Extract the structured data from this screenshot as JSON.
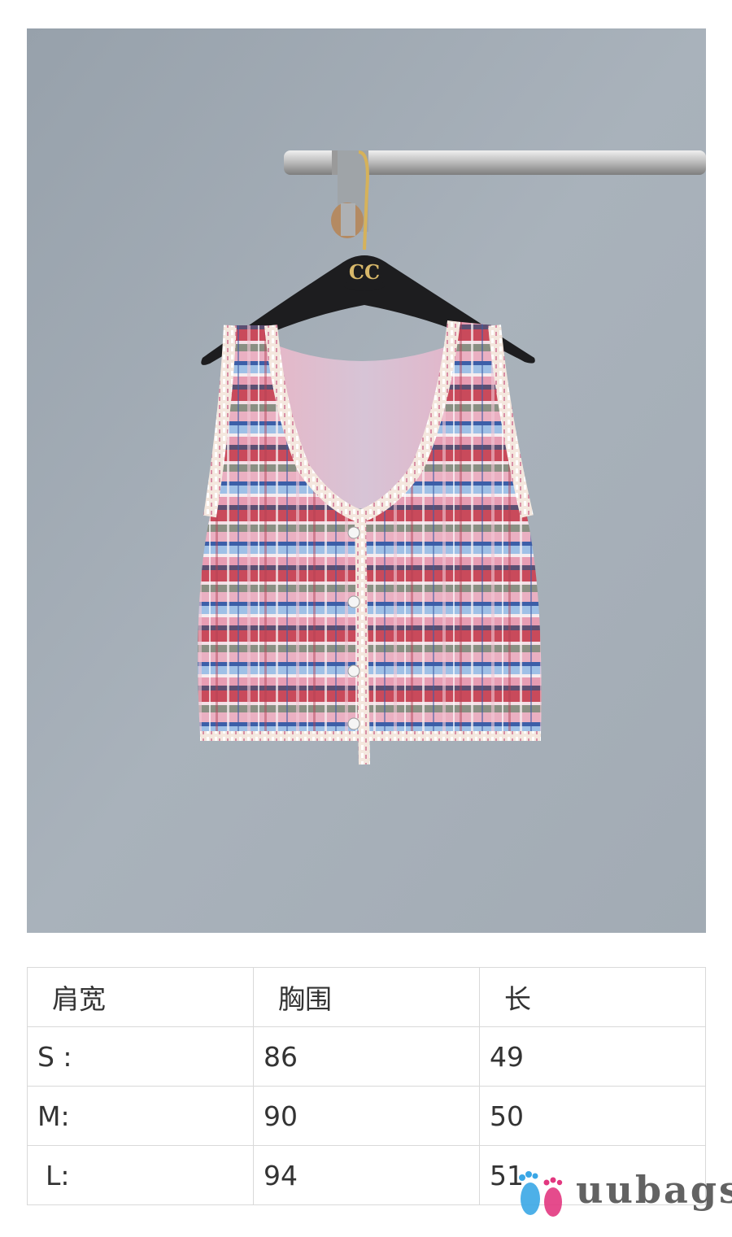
{
  "photo": {
    "hanger_logo": "CC",
    "colors": {
      "wall": "#a4adb6",
      "tweed_pink": "#e6a7bb",
      "tweed_red": "#c94a5b",
      "tweed_blue": "#8fb4e0",
      "hanger": "#1d1d1f",
      "rail": "#c8c8c8"
    }
  },
  "size_table": {
    "headers": [
      "肩宽",
      "胸围",
      "长"
    ],
    "rows": [
      [
        "S :",
        "86",
        "49"
      ],
      [
        "M:",
        "90",
        "50"
      ],
      [
        "L:",
        "94",
        "51"
      ]
    ]
  },
  "watermark": {
    "text": "uubags",
    "icon": "footprints-icon",
    "colors": [
      "#e2377f",
      "#3aa7e6"
    ]
  }
}
